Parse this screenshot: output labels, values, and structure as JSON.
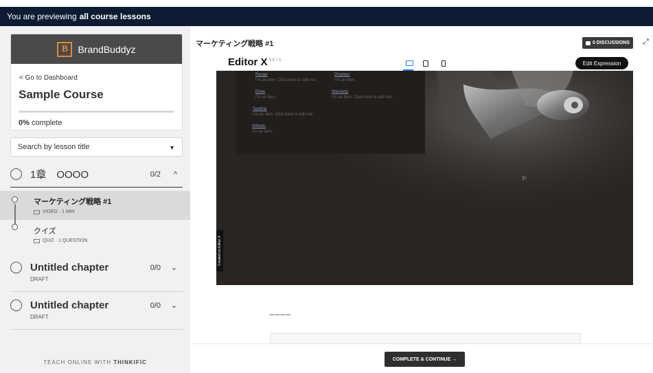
{
  "banner": {
    "prefix": "You are previewing",
    "emphasis": "all course lessons"
  },
  "brand": {
    "logo_letter": "B",
    "name": "BrandBuddyz"
  },
  "course": {
    "back_link": "< Go to Dashboard",
    "title": "Sample Course",
    "progress_percent": 0,
    "progress_value": "0%",
    "progress_suffix": "complete"
  },
  "search": {
    "placeholder": "Search by lesson title",
    "caret": "▼"
  },
  "chapters": [
    {
      "title": "1章　OOOO",
      "count": "0/2",
      "toggle": "^",
      "lessons": [
        {
          "title": "マーケティング戦略 #1",
          "meta": "VIDEO · 1 MIN",
          "active": true
        },
        {
          "title": "クイズ",
          "meta": "QUIZ · 1 QUESTION",
          "active": false
        }
      ]
    },
    {
      "title": "Untitled chapter",
      "count": "0/0",
      "toggle": "⌄",
      "sub": "DRAFT"
    },
    {
      "title": "Untitled chapter",
      "count": "0/0",
      "toggle": "⌄",
      "sub": "DRAFT"
    }
  ],
  "footer": {
    "prefix": "TEACH ONLINE WITH",
    "brand": "THINKIFIC"
  },
  "main": {
    "lesson_heading": "マーケティング戦略 #1",
    "discussions": "0 DISCUSSIONS",
    "expand_icon": "expand-icon",
    "editor": {
      "name": "Editor X",
      "badge": "BETA",
      "edit_button": "Edit Expression"
    },
    "preview_menu": [
      {
        "title": "Range",
        "desc": "I'm an item. Click here to edit me."
      },
      {
        "title": "Displays",
        "desc": "I'm an item."
      },
      {
        "title": "Drive",
        "desc": "I'm an item."
      },
      {
        "title": "Warranty",
        "desc": "I'm an item. Click here to edit me."
      },
      {
        "title": "Seating",
        "desc": "I'm an item. Click here to edit me."
      },
      {
        "title": "Wheels",
        "desc": "I'm an item."
      }
    ],
    "created_badge": "Created on Editor X",
    "dash": "____",
    "complete_button": "COMPLETE & CONTINUE →"
  },
  "colors": {
    "navy": "#0d1c33",
    "brand_orange": "#e0883a",
    "editor_blue": "#2c7be5"
  }
}
